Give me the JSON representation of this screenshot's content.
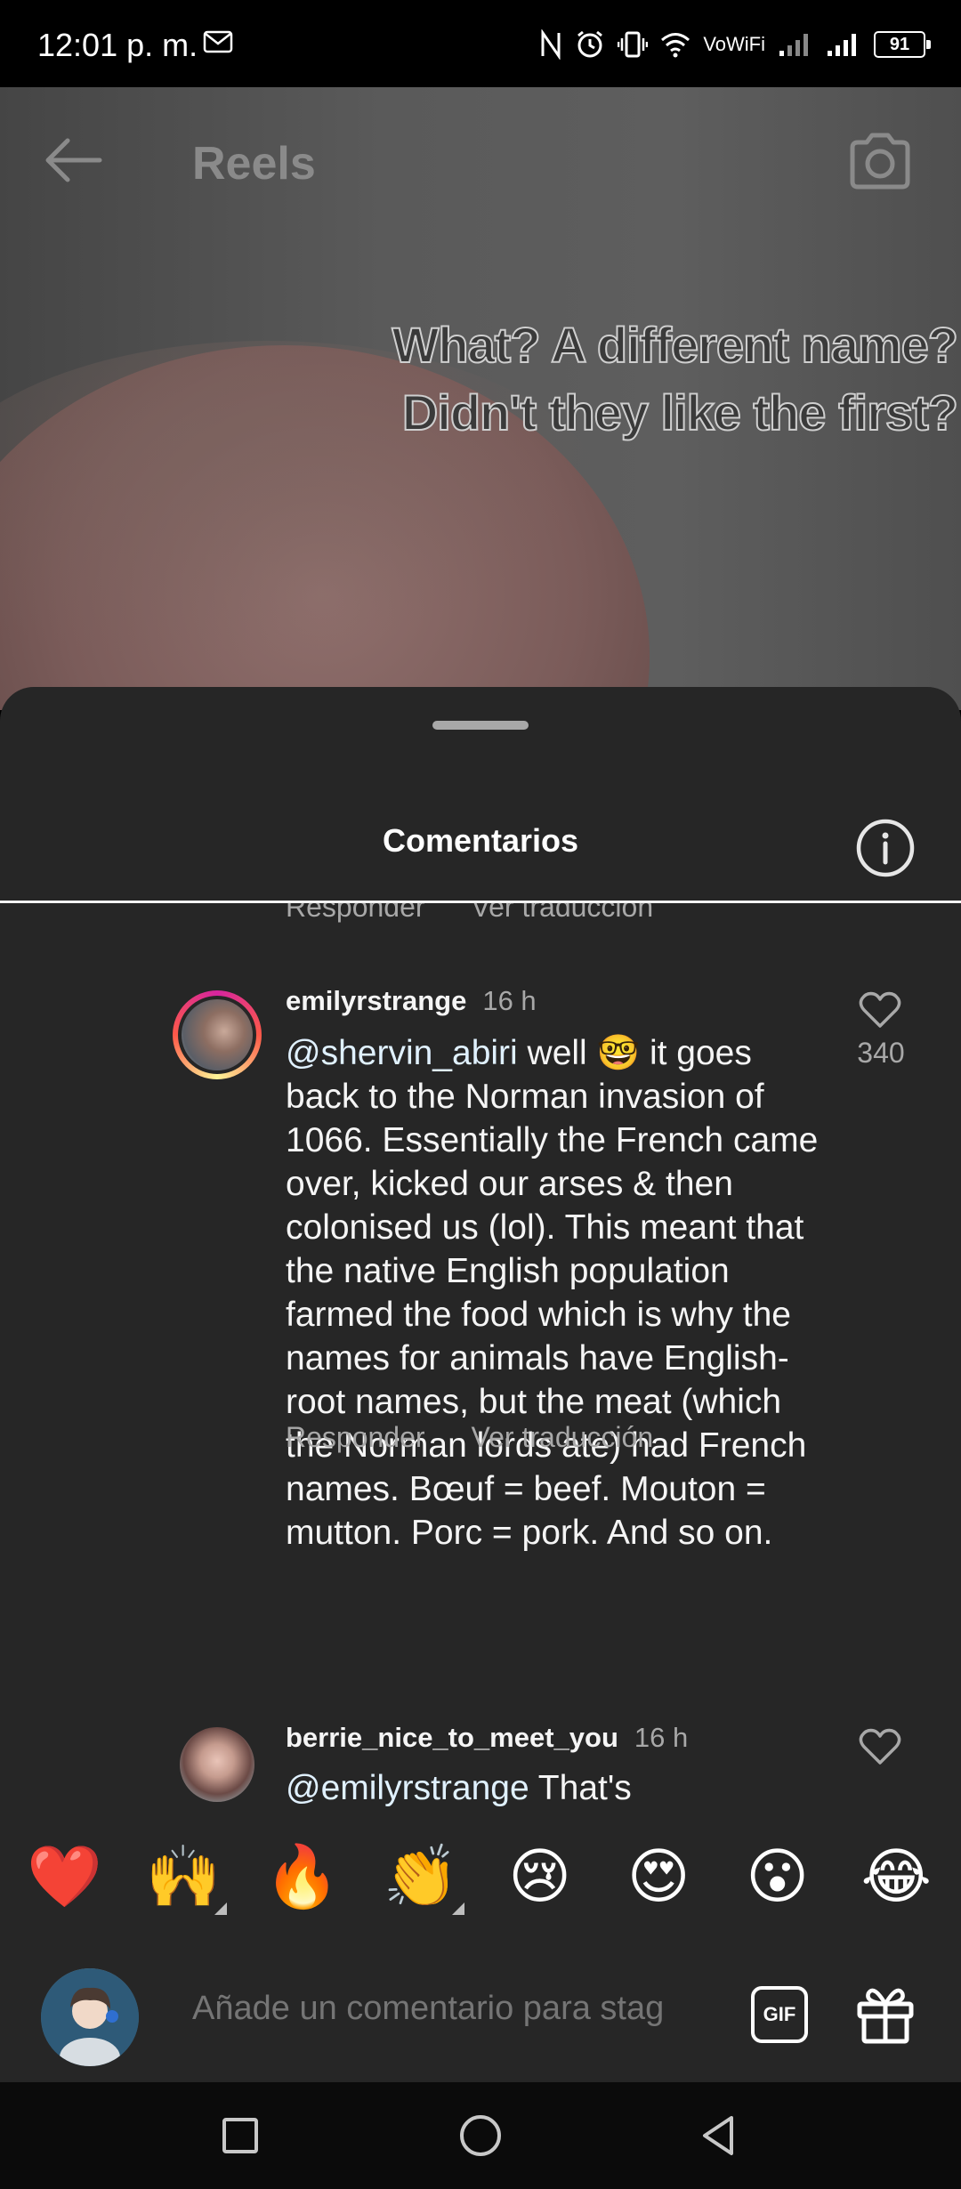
{
  "status_bar": {
    "time": "12:01 p. m.",
    "network_label": "VoWiFi",
    "battery": "91"
  },
  "header": {
    "title": "Reels"
  },
  "video": {
    "caption_line1": "What? A different name?",
    "caption_line2": "Didn't they like the first?"
  },
  "sheet": {
    "title": "Comentarios",
    "previous_actions": {
      "reply": "Responder",
      "translate": "Ver traducción"
    },
    "comments": [
      {
        "username": "emilyrstrange",
        "time": "16 h",
        "mention": "@shervin_abiri",
        "text_a": " well ",
        "emoji": "🤓",
        "text_b": " it goes back to the Norman invasion of 1066. Essentially the French came over, kicked our arses & then colonised us (lol). This meant that the native English population farmed the food which is why the names for animals have English-root names, but the meat (which the Norman lords ate) had French names. Bœuf = beef. Mouton = mutton. Porc = pork. And so on.",
        "likes": "340",
        "reply": "Responder",
        "translate": "Ver traducción"
      },
      {
        "username": "berrie_nice_to_meet_you",
        "time": "16 h",
        "mention": "@emilyrstrange",
        "text": " That's"
      }
    ]
  },
  "emoji_bar": [
    {
      "char": "❤️",
      "name": "heart"
    },
    {
      "char": "🙌",
      "name": "raising-hands"
    },
    {
      "char": "🔥",
      "name": "fire"
    },
    {
      "char": "👏",
      "name": "clapping-hands"
    },
    {
      "char": "😢",
      "name": "crying-face"
    },
    {
      "char": "😍",
      "name": "heart-eyes"
    },
    {
      "char": "😮",
      "name": "open-mouth"
    },
    {
      "char": "😂",
      "name": "tears-of-joy"
    }
  ],
  "input": {
    "placeholder": "Añade un comentario para stag",
    "gif_label": "GIF"
  },
  "colors": {
    "sheet_bg": "#262626",
    "secondary_text": "#a8a8a8",
    "primary_text": "#f5f5f5"
  }
}
